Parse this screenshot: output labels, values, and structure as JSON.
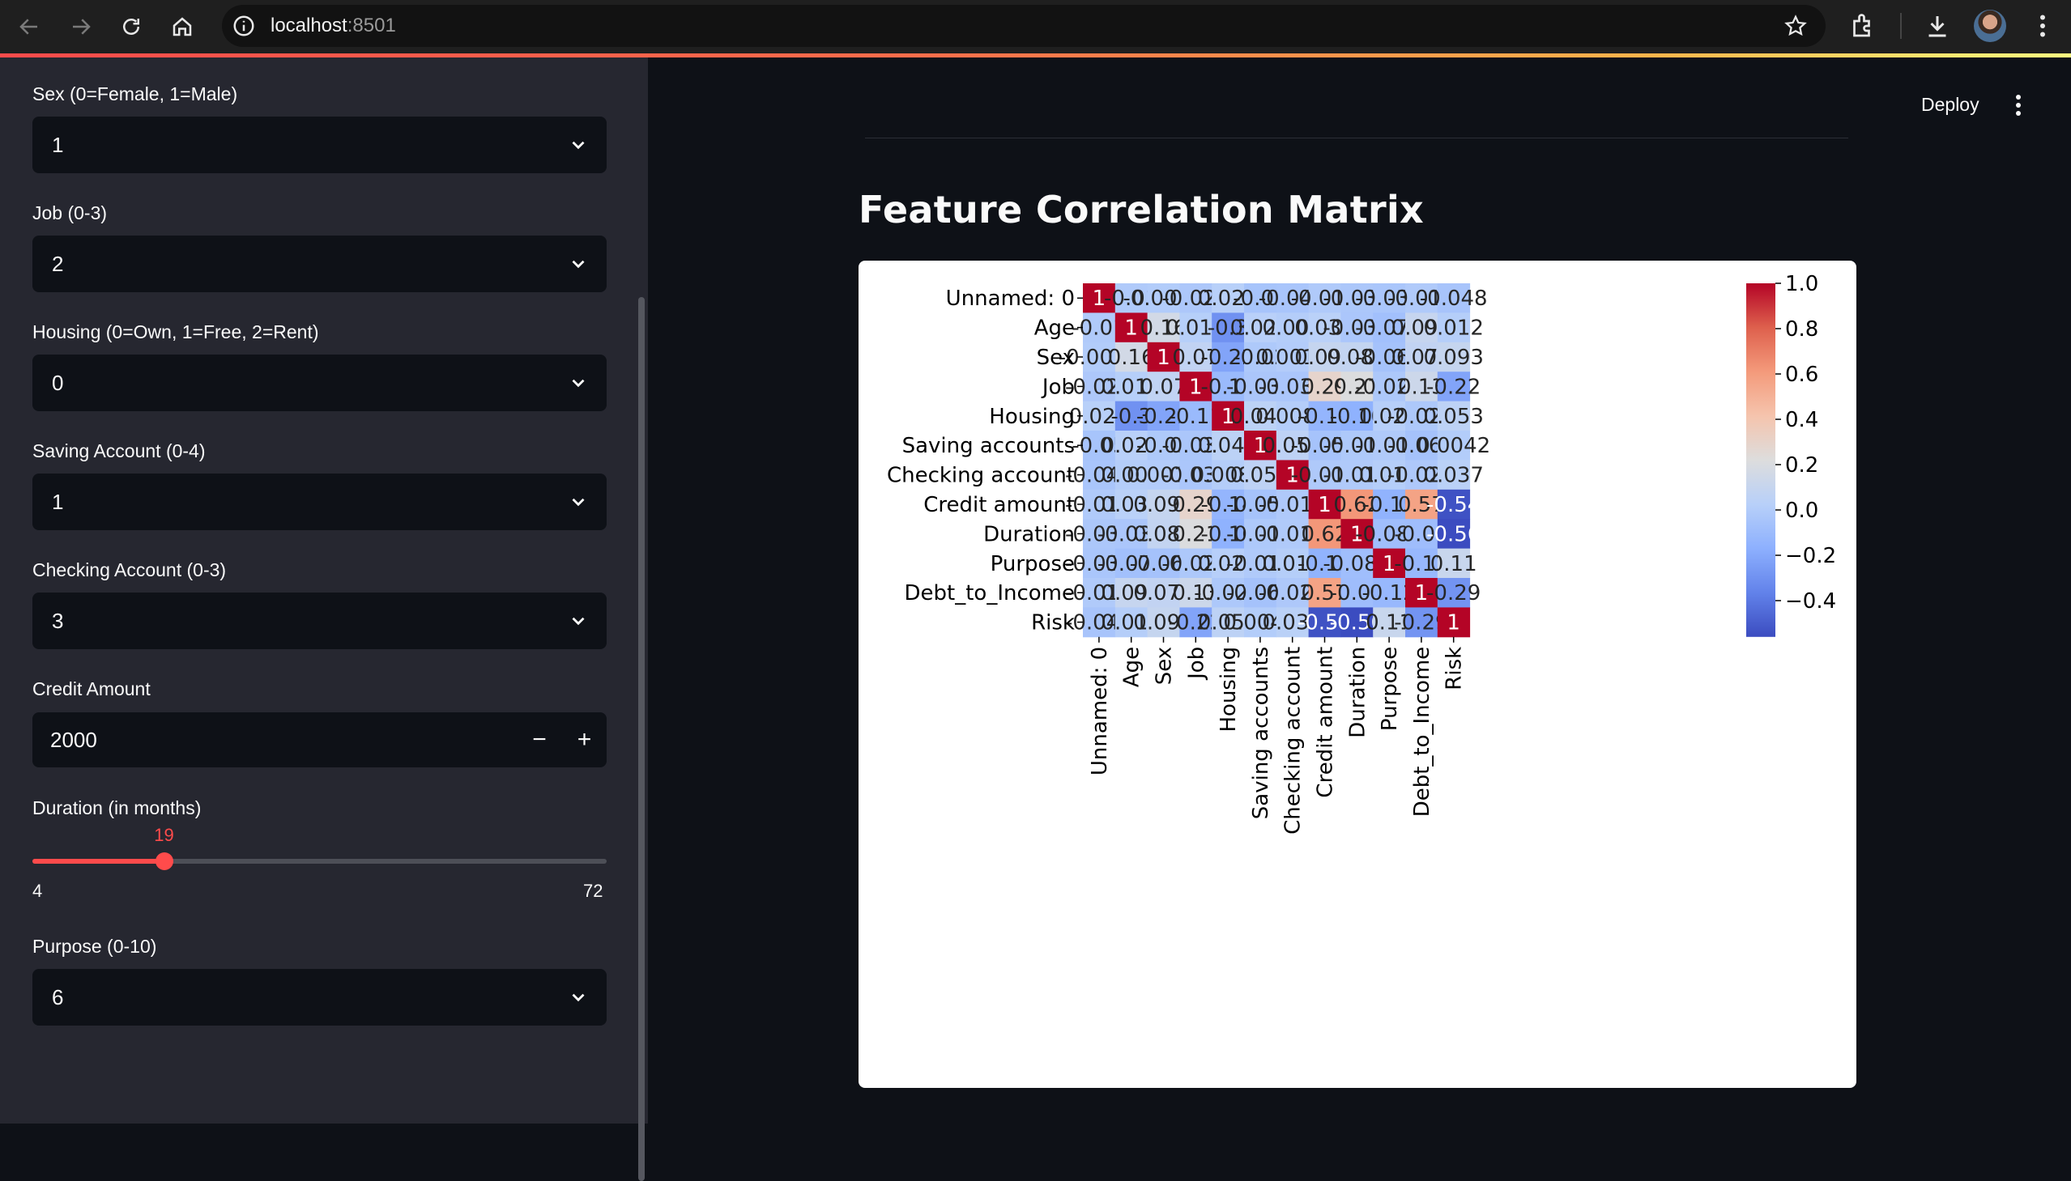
{
  "browser": {
    "url_host": "localhost",
    "url_port": ":8501"
  },
  "sidebar": {
    "sex": {
      "label": "Sex (0=Female, 1=Male)",
      "value": "1"
    },
    "job": {
      "label": "Job (0-3)",
      "value": "2"
    },
    "housing": {
      "label": "Housing (0=Own, 1=Free, 2=Rent)",
      "value": "0"
    },
    "saving": {
      "label": "Saving Account (0-4)",
      "value": "1"
    },
    "checking": {
      "label": "Checking Account (0-3)",
      "value": "3"
    },
    "credit": {
      "label": "Credit Amount",
      "value": "2000",
      "minus": "−",
      "plus": "+"
    },
    "duration": {
      "label": "Duration (in months)",
      "value": 19,
      "value_text": "19",
      "min": 4,
      "max": 72,
      "min_text": "4",
      "max_text": "72"
    },
    "purpose": {
      "label": "Purpose (0-10)",
      "value": "6"
    }
  },
  "header": {
    "deploy_label": "Deploy"
  },
  "main": {
    "title": "Feature Correlation Matrix"
  },
  "chart_data": {
    "type": "heatmap",
    "title": "",
    "labels": [
      "Unnamed: 0",
      "Age",
      "Sex",
      "Job",
      "Housing",
      "Saving accounts",
      "Checking account",
      "Credit amount",
      "Duration",
      "Purpose",
      "Debt_to_Income",
      "Risk"
    ],
    "values": [
      [
        1,
        -0.01,
        -0.0017,
        -0.027,
        0.025,
        -0.05,
        -0.043,
        -0.013,
        -0.031,
        -0.037,
        -0.012,
        -0.048
      ],
      [
        -0.01,
        1,
        0.16,
        0.016,
        -0.3,
        0.028,
        0.008,
        0.033,
        -0.036,
        -0.074,
        0.098,
        0.012
      ],
      [
        -0.0017,
        0.16,
        1,
        0.07,
        -0.22,
        -0.02,
        0.0016,
        0.093,
        0.081,
        -0.063,
        0.076,
        0.093
      ],
      [
        -0.027,
        0.016,
        0.07,
        1,
        -0.11,
        -0.033,
        -0.036,
        0.29,
        0.21,
        -0.025,
        0.13,
        -0.22
      ],
      [
        0.025,
        -0.3,
        -0.22,
        -0.11,
        1,
        0.048,
        0.0082,
        -0.14,
        -0.16,
        0.021,
        -0.026,
        0.053
      ],
      [
        -0.05,
        0.028,
        -0.02,
        -0.033,
        0.048,
        1,
        0.056,
        -0.056,
        -0.019,
        -0.013,
        -0.061,
        0.0042
      ],
      [
        -0.043,
        0.008,
        0.0016,
        -0.036,
        0.0082,
        0.056,
        1,
        -0.016,
        -0.012,
        0.013,
        -0.022,
        0.037
      ],
      [
        -0.013,
        0.033,
        0.093,
        0.29,
        -0.14,
        -0.056,
        -0.016,
        1,
        0.62,
        -0.15,
        0.57,
        -0.54
      ],
      [
        -0.031,
        -0.036,
        0.081,
        0.21,
        -0.16,
        -0.019,
        -0.012,
        0.62,
        1,
        -0.083,
        -0.09,
        -0.56
      ],
      [
        -0.037,
        -0.074,
        -0.063,
        -0.025,
        0.021,
        -0.013,
        0.013,
        -0.15,
        -0.083,
        1,
        -0.12,
        0.11
      ],
      [
        -0.012,
        0.098,
        0.076,
        0.13,
        -0.026,
        -0.061,
        -0.022,
        0.57,
        -0.09,
        -0.12,
        1,
        -0.29
      ],
      [
        -0.048,
        0.012,
        0.093,
        -0.22,
        0.053,
        0.0042,
        0.037,
        -0.54,
        -0.56,
        0.11,
        -0.29,
        1
      ]
    ],
    "colormap": "coolwarm",
    "vmin": -0.56,
    "vmax": 1.0,
    "colorbar_ticks": [
      1.0,
      0.8,
      0.6,
      0.4,
      0.2,
      0.0,
      -0.2,
      -0.4
    ],
    "colorbar_tick_labels": [
      "1.0",
      "0.8",
      "0.6",
      "0.4",
      "0.2",
      "0.0",
      "−0.2",
      "−0.4"
    ]
  }
}
